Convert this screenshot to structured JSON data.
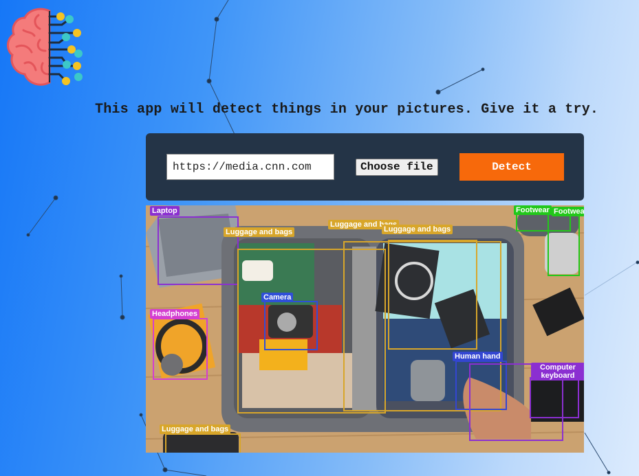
{
  "tagline": "This app will detect things in your pictures. Give it a try.",
  "controls": {
    "url_value": "https://media.cnn.com",
    "choose_file_label": "Choose file",
    "detect_label": "Detect"
  },
  "colors": {
    "background_start": "#1677f7",
    "background_end": "#dcebfd",
    "panel": "#243447",
    "detect_button": "#f7690b",
    "luggage": "#d8a62a",
    "electronics": "#8b2fd1",
    "camera": "#2f4fd8",
    "headphones": "#d43ed1",
    "footwear": "#22c81a",
    "human_hand": "#3346d1"
  },
  "logo": {
    "icon": "brain-circuit-icon"
  },
  "detections": [
    {
      "label": "Laptop",
      "color": "#8b2fd1"
    },
    {
      "label": "Luggage and bags",
      "color": "#d8a62a"
    },
    {
      "label": "Luggage and bags",
      "color": "#d8a62a"
    },
    {
      "label": "Luggage and bags",
      "color": "#d8a62a"
    },
    {
      "label": "Footwear",
      "color": "#22c81a"
    },
    {
      "label": "Footwear",
      "color": "#22c81a"
    },
    {
      "label": "Camera",
      "color": "#2f4fd8"
    },
    {
      "label": "Headphones",
      "color": "#d43ed1"
    },
    {
      "label": "Human hand",
      "color": "#3346d1"
    },
    {
      "label": "Computer keyboard",
      "color": "#8b2fd1"
    },
    {
      "label": "Luggage and bags",
      "color": "#d8a62a"
    }
  ]
}
